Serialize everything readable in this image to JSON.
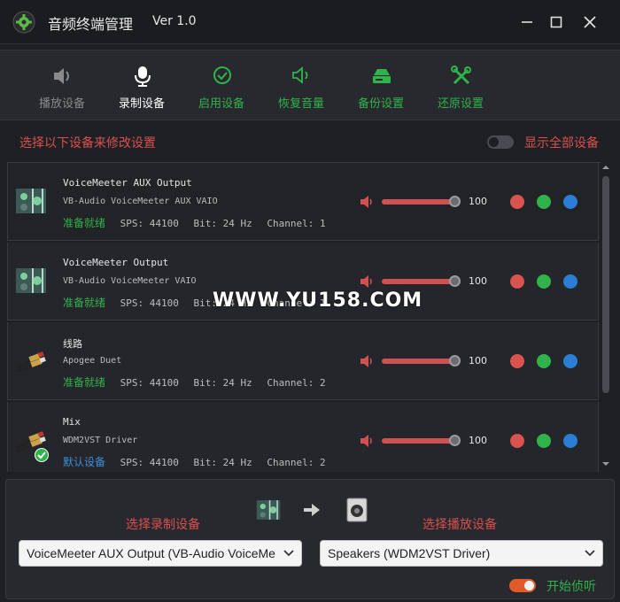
{
  "window": {
    "title": "音频终端管理",
    "version": "Ver 1.0"
  },
  "toolbar": [
    {
      "label": "播放设备",
      "icon": "speaker-icon",
      "color": "#8a8a8a"
    },
    {
      "label": "录制设备",
      "icon": "microphone-icon",
      "color": "#ffffff"
    },
    {
      "label": "启用设备",
      "icon": "check-circle-icon",
      "color": "#2fb34a"
    },
    {
      "label": "恢复音量",
      "icon": "volume-restore-icon",
      "color": "#2fb34a"
    },
    {
      "label": "备份设置",
      "icon": "backup-icon",
      "color": "#2fb34a"
    },
    {
      "label": "还原设置",
      "icon": "tools-icon",
      "color": "#2fb34a"
    }
  ],
  "hint": "选择以下设备来修改设置",
  "show_all": {
    "label": "显示全部设备",
    "checked": false
  },
  "devices": [
    {
      "name": "VoiceMeeter AUX Output",
      "desc": "VB-Audio VoiceMeeter AUX VAIO",
      "status": "准备就绪",
      "status_color": "#2fb34a",
      "sps": "SPS: 44100",
      "bit": "Bit: 24 Hz",
      "channel": "Channel: 1",
      "volume": "100",
      "volume_level": 1.0,
      "icon": "voicemeeter-icon"
    },
    {
      "name": "VoiceMeeter Output",
      "desc": "VB-Audio VoiceMeeter VAIO",
      "status": "准备就绪",
      "status_color": "#2fb34a",
      "sps": "SPS: 44100",
      "bit": "Bit: 24 Hz",
      "channel": "Channel: 1",
      "volume": "100",
      "volume_level": 1.0,
      "icon": "voicemeeter-icon"
    },
    {
      "name": "线路",
      "desc": "Apogee Duet",
      "status": "准备就绪",
      "status_color": "#2fb34a",
      "sps": "SPS: 44100",
      "bit": "Bit: 24 Hz",
      "channel": "Channel: 2",
      "volume": "100",
      "volume_level": 1.0,
      "icon": "rca-cable-icon"
    },
    {
      "name": "Mix",
      "desc": "WDM2VST Driver",
      "status": "默认设备",
      "status_color": "#3a8fd9",
      "sps": "SPS: 44100",
      "bit": "Bit: 24 Hz",
      "channel": "Channel: 2",
      "volume": "100",
      "volume_level": 1.0,
      "icon": "rca-cable-icon"
    }
  ],
  "dot_colors": [
    "#d9534f",
    "#2fb34a",
    "#2a7fd4"
  ],
  "bottom": {
    "record_label": "选择录制设备",
    "play_label": "选择播放设备",
    "record_value": "VoiceMeeter AUX Output (VB-Audio VoiceMe",
    "play_value": "Speakers (WDM2VST Driver)",
    "listen_label": "开始侦听",
    "listen_on": true
  },
  "watermark": "WWW.YU158.COM"
}
